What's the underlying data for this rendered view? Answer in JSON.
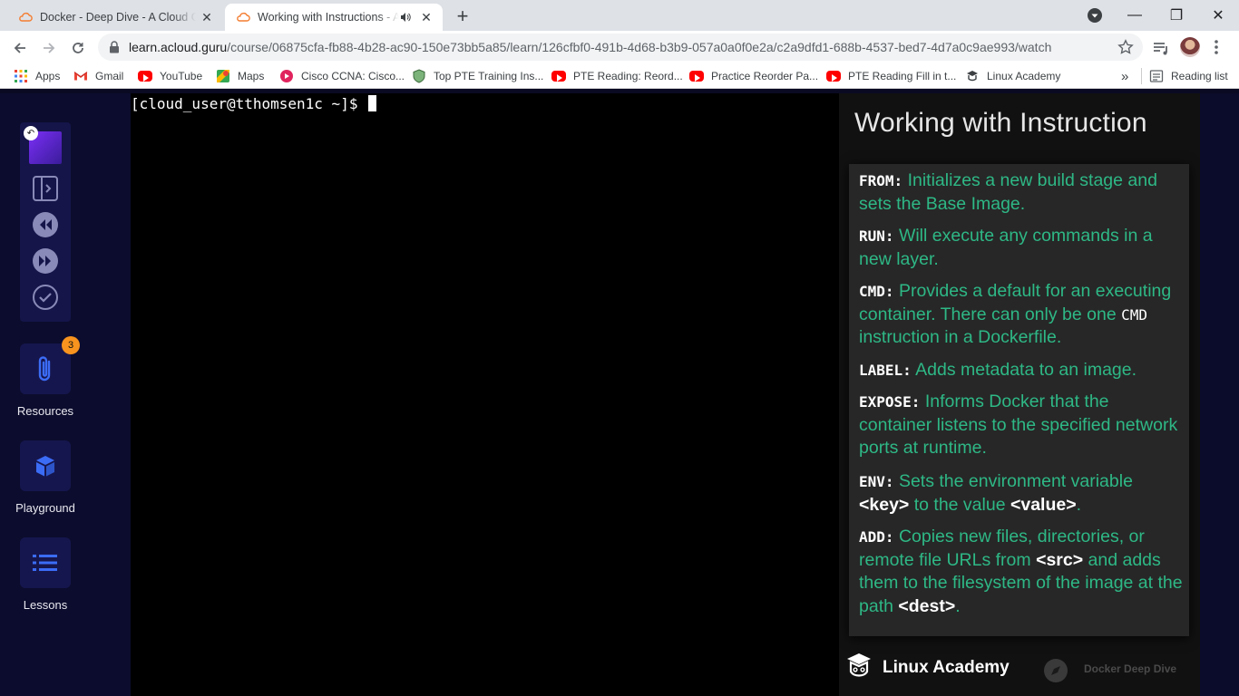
{
  "browser": {
    "tabs": [
      {
        "title": "Docker - Deep Dive - A Cloud Gu",
        "close": "✕"
      },
      {
        "title": "Working with Instructions - A",
        "close": "✕"
      }
    ],
    "new_tab": "+",
    "window_controls": {
      "minimize": "—",
      "restore": "❐",
      "close": "✕"
    },
    "url_host": "learn.acloud.guru",
    "url_path": "/course/06875cfa-fb88-4b28-ac90-150e73bb5a85/learn/126cfbf0-491b-4d68-b3b9-057a0a0f0e2a/c2a9dfd1-688b-4537-bed7-4d7a0c9ae993/watch",
    "bookmarks": [
      {
        "label": "Apps"
      },
      {
        "label": "Gmail"
      },
      {
        "label": "YouTube"
      },
      {
        "label": "Maps"
      },
      {
        "label": "Cisco CCNA: Cisco..."
      },
      {
        "label": "Top PTE Training Ins..."
      },
      {
        "label": "PTE Reading: Reord..."
      },
      {
        "label": "Practice Reorder Pa..."
      },
      {
        "label": "PTE Reading Fill in t..."
      },
      {
        "label": "Linux Academy"
      }
    ],
    "bookmarks_overflow": "»",
    "reading_list": "Reading list"
  },
  "sidebar": {
    "resources_label": "Resources",
    "resources_badge": "3",
    "playground_label": "Playground",
    "lessons_label": "Lessons"
  },
  "terminal": {
    "prompt": "[cloud_user@tthomsen1c ~]$ "
  },
  "slide": {
    "title": "Working with Instruction",
    "items": [
      {
        "keyword": "FROM:",
        "text": " Initializes a new build stage and sets the Base Image."
      },
      {
        "keyword": "RUN:",
        "text": " Will execute any commands in a new layer."
      },
      {
        "keyword": "CMD:",
        "text": " Provides a default for an executing container. There can only be one ",
        "inline_code": "CMD",
        "text2": " instruction in a Dockerfile."
      },
      {
        "keyword": "LABEL:",
        "text": " Adds metadata to an image."
      },
      {
        "keyword": "EXPOSE:",
        "text": " Informs Docker that the container listens to the specified network ports at runtime."
      },
      {
        "keyword": "ENV:",
        "text": " Sets the environment variable ",
        "b1": "<key>",
        "text2": " to the value ",
        "b2": "<value>",
        "text3": "."
      },
      {
        "keyword": "ADD:",
        "text": " Copies new files, directories, or remote file URLs from ",
        "b1": "<src>",
        "text2": " and adds them to the filesystem of the image at the path ",
        "b2": "<dest>",
        "text3": "."
      }
    ],
    "footer_brand": "Linux Academy",
    "footer_course": "Docker Deep Dive"
  },
  "colors": {
    "slide_text": "#2eb886",
    "page_bg": "#0b0b2b",
    "badge": "#f7931e",
    "accent_blue": "#3b6cf6"
  }
}
